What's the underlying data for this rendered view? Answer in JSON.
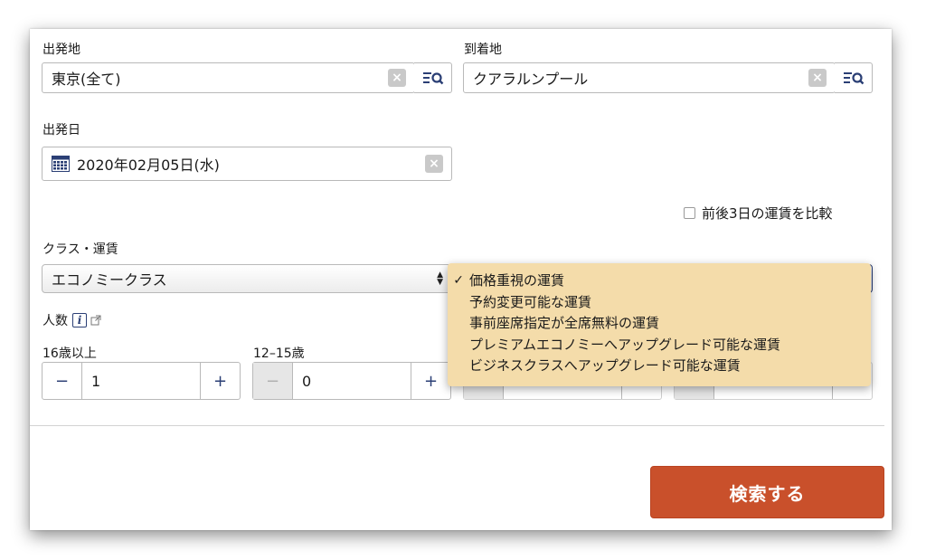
{
  "origin": {
    "label": "出発地",
    "value": "東京(全て)"
  },
  "destination": {
    "label": "到着地",
    "value": "クアラルンプール"
  },
  "clear_symbol": "×",
  "departure": {
    "label": "出発日",
    "value": "2020年02月05日(水)"
  },
  "compare": {
    "label": "前後3日の運賃を比較",
    "checked": false
  },
  "class_fare": {
    "label": "クラス・運賃",
    "class_value": "エコノミークラス",
    "fare_options": [
      {
        "label": "価格重視の運賃",
        "selected": true,
        "check": "✓"
      },
      {
        "label": "予約変更可能な運賃",
        "selected": false
      },
      {
        "label": "事前座席指定が全席無料の運賃",
        "selected": false
      },
      {
        "label": "プレミアムエコノミーへアップグレード可能な運賃",
        "selected": false
      },
      {
        "label": "ビジネスクラスへアップグレード可能な運賃",
        "selected": false
      }
    ]
  },
  "passengers": {
    "label": "人数",
    "adult": {
      "label": "16歳以上",
      "value": "1",
      "minus": "−",
      "plus": "+"
    },
    "youth": {
      "label": "12–15歳",
      "value": "0",
      "minus": "−",
      "plus": "+"
    }
  },
  "search_button": {
    "label": "検索する"
  },
  "colors": {
    "accent": "#c9502b",
    "dropdown_bg": "#f4dcaa",
    "icon_blue": "#2b3f75"
  }
}
